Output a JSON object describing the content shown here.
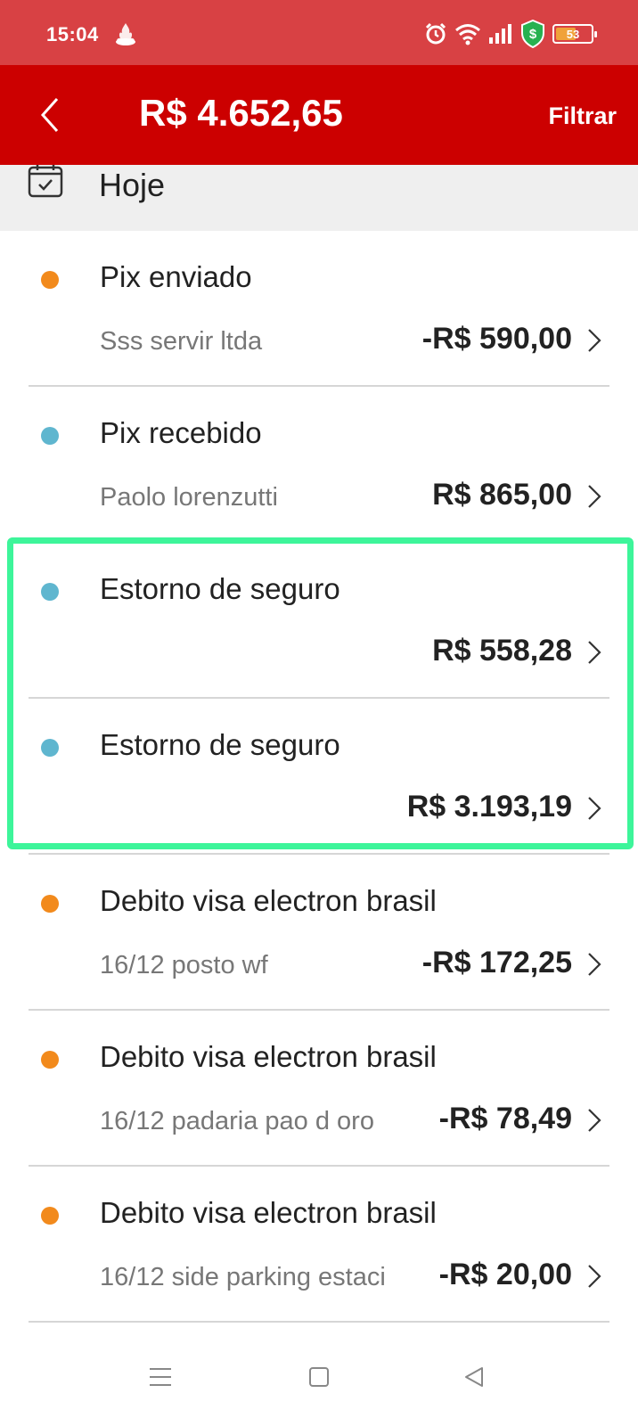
{
  "status_bar": {
    "time": "15:04",
    "battery": "53",
    "icons": [
      "santander-flame-icon",
      "alarm-icon",
      "wifi-icon",
      "signal-icon",
      "shield-dollar-icon",
      "battery-icon"
    ]
  },
  "header": {
    "back_icon": "chevron-left-icon",
    "balance": "R$ 4.652,65",
    "filter_label": "Filtrar"
  },
  "date_section": {
    "icon": "calendar-check-icon",
    "label": "Hoje"
  },
  "colors": {
    "header_red": "#cc0000",
    "status_red": "#d84144",
    "dot_orange": "#f28a1c",
    "dot_blue": "#5fb6cf",
    "highlight_green": "#3df59a"
  },
  "transactions": [
    {
      "title": "Pix enviado",
      "description": "Sss servir ltda",
      "amount": "-R$ 590,00",
      "type": "outgoing"
    },
    {
      "title": "Pix recebido",
      "description": "Paolo lorenzutti",
      "amount": "R$ 865,00",
      "type": "incoming"
    },
    {
      "title": "Estorno de seguro",
      "description": "",
      "amount": "R$ 558,28",
      "type": "incoming"
    },
    {
      "title": "Estorno de seguro",
      "description": "",
      "amount": "R$ 3.193,19",
      "type": "incoming"
    },
    {
      "title": "Debito visa electron brasil",
      "description": "16/12 posto wf",
      "amount": "-R$ 172,25",
      "type": "outgoing"
    },
    {
      "title": "Debito visa electron brasil",
      "description": "16/12 padaria pao d oro",
      "amount": "-R$ 78,49",
      "type": "outgoing"
    },
    {
      "title": "Debito visa electron brasil",
      "description": "16/12 side parking estaci",
      "amount": "-R$ 20,00",
      "type": "outgoing"
    }
  ],
  "nav_bar": {
    "icons": [
      "menu-icon",
      "home-square-icon",
      "back-triangle-icon"
    ]
  }
}
